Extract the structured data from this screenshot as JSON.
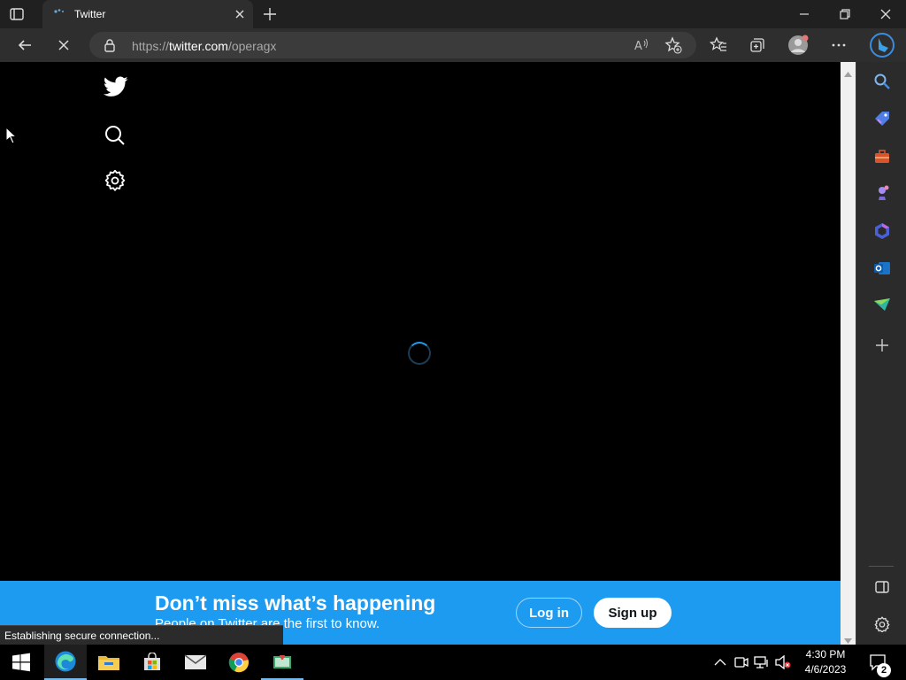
{
  "browser": {
    "tab_title": "Twitter",
    "url_scheme": "https://",
    "url_host": "twitter.com",
    "url_path": "/operagx",
    "accent": "#1d9bf0"
  },
  "page": {
    "banner_title": "Don’t miss what’s happening",
    "banner_subtitle": "People on Twitter are the first to know.",
    "login_label": "Log in",
    "signup_label": "Sign up",
    "status_text": "Establishing secure connection..."
  },
  "taskbar": {
    "time": "4:30 PM",
    "date": "4/6/2023",
    "notification_count": "2"
  }
}
